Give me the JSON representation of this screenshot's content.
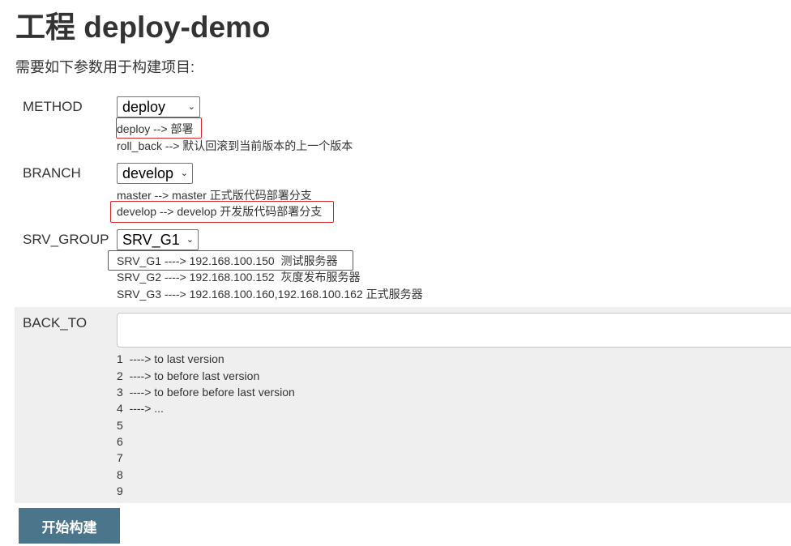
{
  "title": "工程 deploy-demo",
  "subtitle": "需要如下参数用于构建项目:",
  "params": {
    "method": {
      "name": "METHOD",
      "selected": "deploy",
      "descriptions": [
        "deploy --> 部署",
        "roll_back --> 默认回滚到当前版本的上一个版本"
      ]
    },
    "branch": {
      "name": "BRANCH",
      "selected": "develop",
      "descriptions": [
        "master --> master 正式版代码部署分支",
        "develop --> develop 开发版代码部署分支"
      ]
    },
    "srv_group": {
      "name": "SRV_GROUP",
      "selected": "SRV_G1",
      "descriptions": [
        "SRV_G1 ----> 192.168.100.150  测试服务器",
        "SRV_G2 ----> 192.168.100.152  灰度发布服务器",
        "SRV_G3 ----> 192.168.100.160,192.168.100.162 正式服务器"
      ]
    },
    "back_to": {
      "name": "BACK_TO",
      "value": "",
      "descriptions": [
        "1  ----> to last version",
        "2  ----> to before last version",
        "3  ----> to before before last version",
        "4  ----> ...",
        "5",
        "6",
        "7",
        "8",
        "9"
      ]
    }
  },
  "build_button": "开始构建",
  "colors": {
    "highlight": "#d9262b",
    "button": "#4b758b",
    "panel": "#efefef"
  }
}
